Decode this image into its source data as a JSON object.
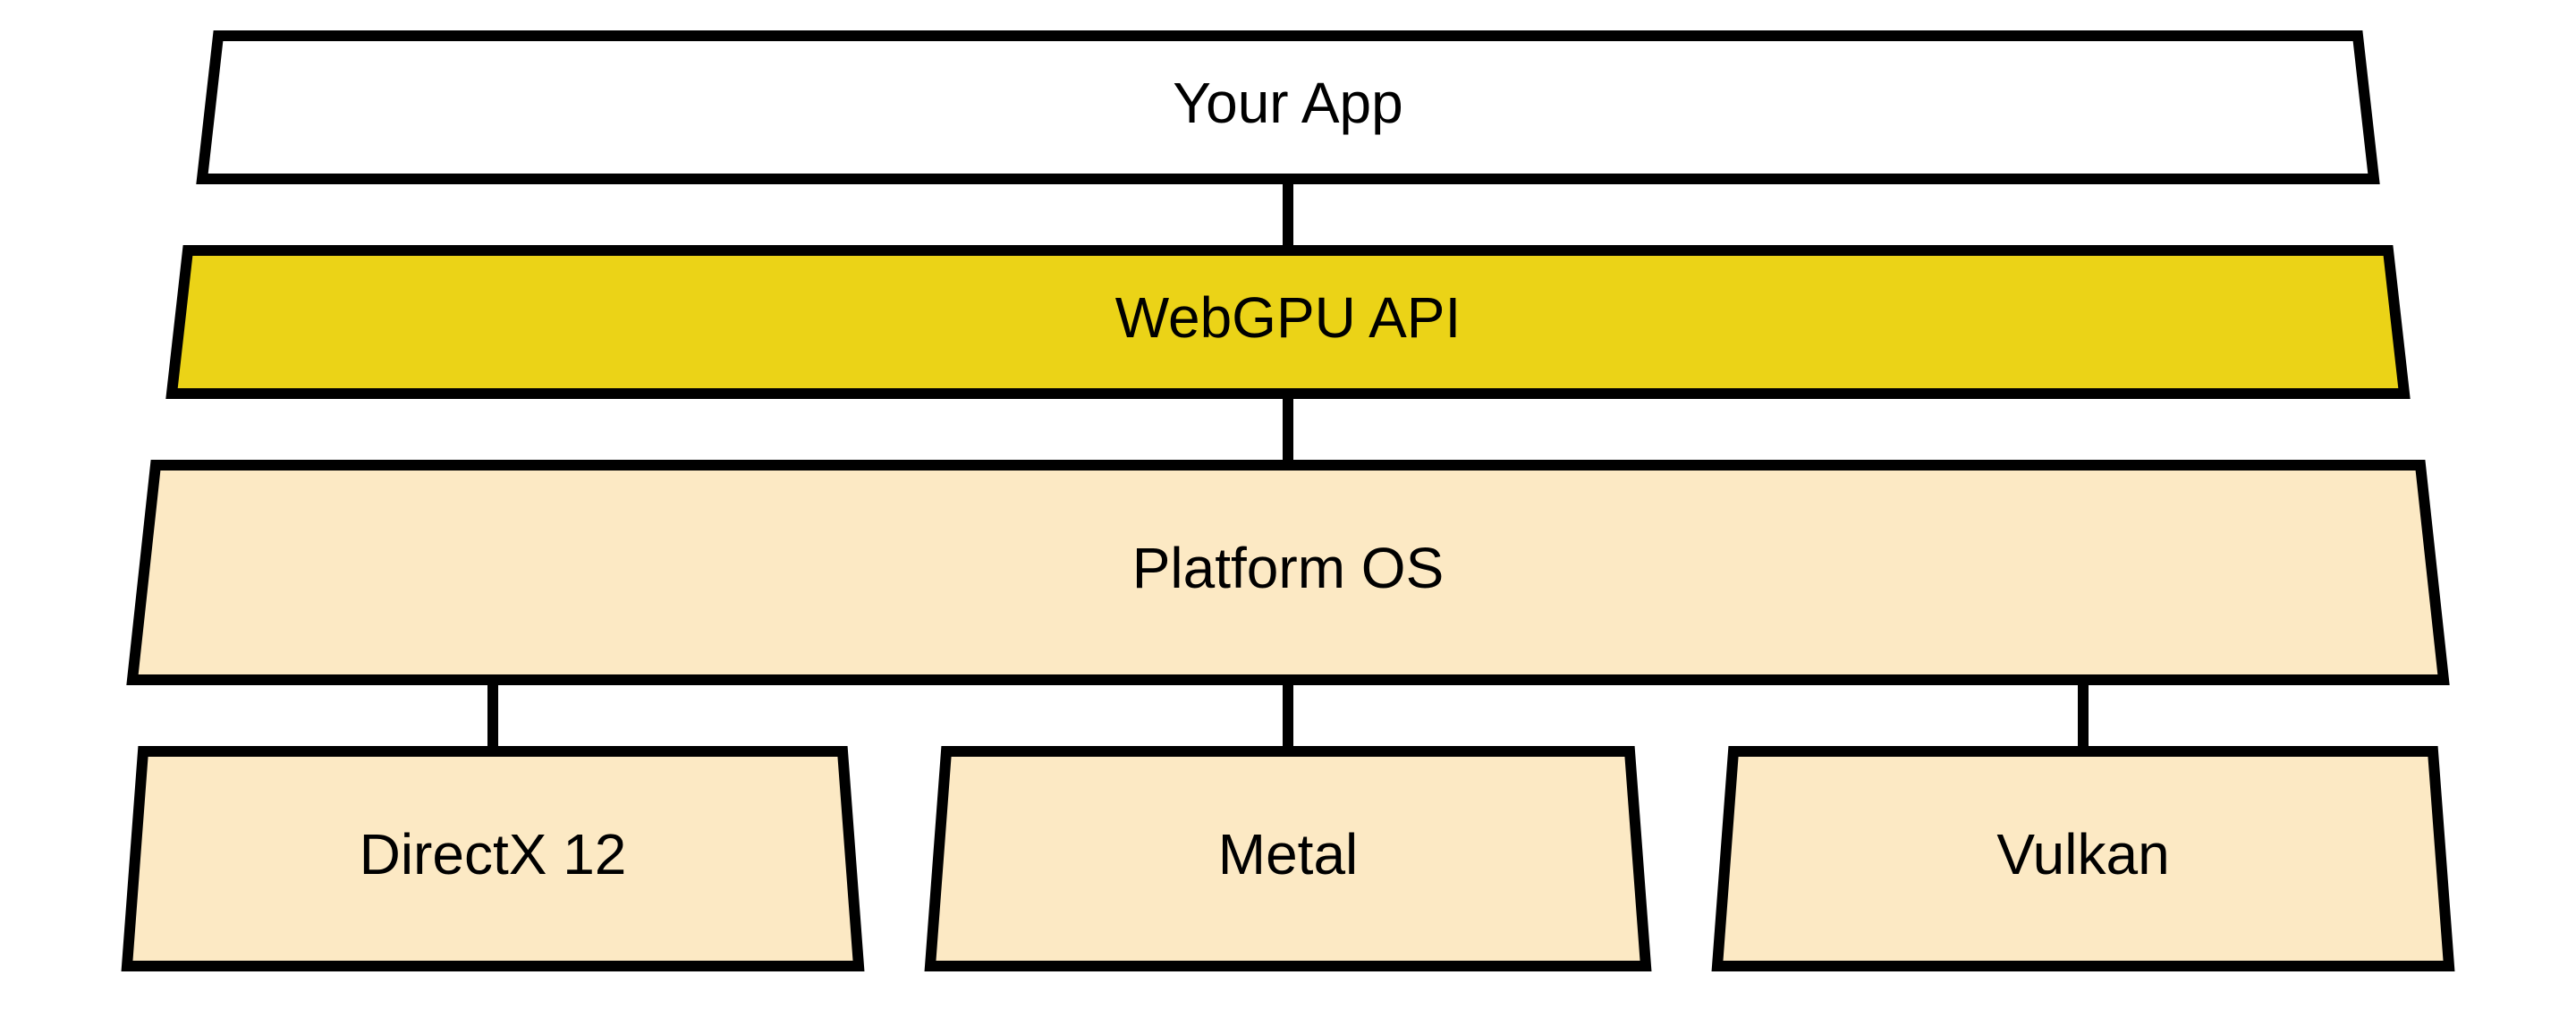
{
  "colors": {
    "white": "#ffffff",
    "yellow": "#ebd317",
    "cream": "#fce9c4",
    "stroke": "#000000"
  },
  "layers": {
    "app": {
      "label": "Your App"
    },
    "api": {
      "label": "WebGPU API"
    },
    "os": {
      "label": "Platform OS"
    },
    "backends": [
      {
        "label": "DirectX 12"
      },
      {
        "label": "Metal"
      },
      {
        "label": "Vulkan"
      }
    ]
  }
}
